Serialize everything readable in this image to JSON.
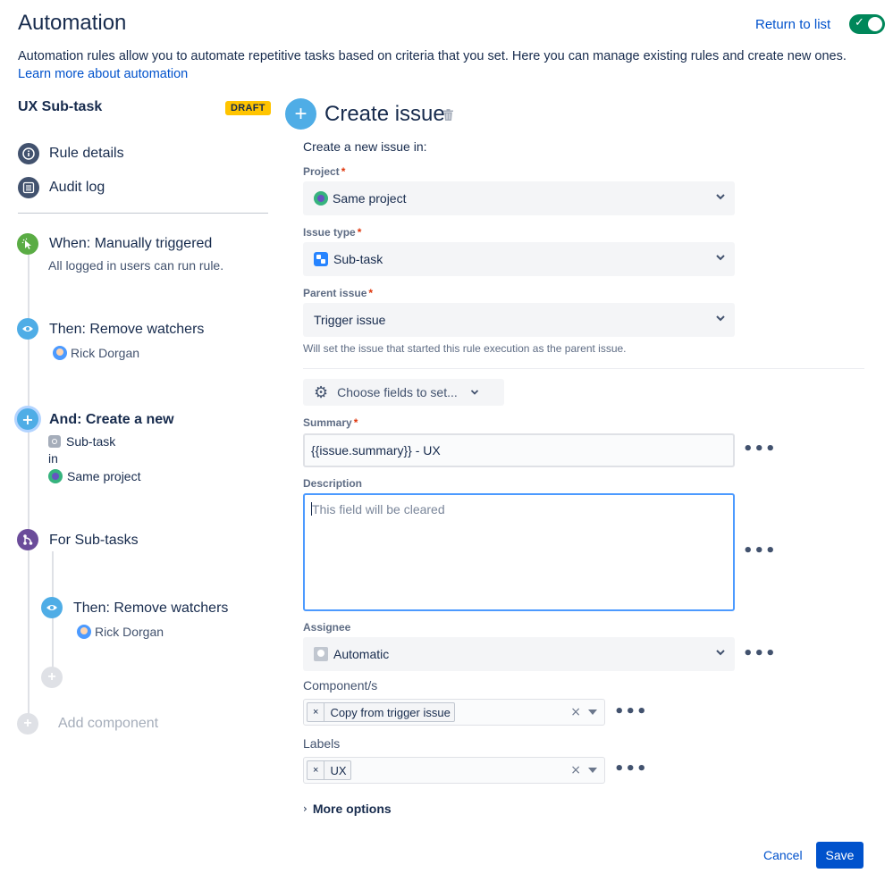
{
  "header": {
    "title": "Automation",
    "return_label": "Return to list",
    "toggle_on": true,
    "intro_text": "Automation rules allow you to automate repetitive tasks based on criteria that you set. Here you can manage existing rules and create new ones. ",
    "intro_link": "Learn more about automation"
  },
  "rule": {
    "name": "UX Sub-task",
    "badge": "DRAFT",
    "nav": [
      {
        "label": "Rule details",
        "icon": "info-icon"
      },
      {
        "label": "Audit log",
        "icon": "list-icon"
      }
    ]
  },
  "steps": {
    "trigger": {
      "title": "When: Manually triggered",
      "sub": "All logged in users can run rule.",
      "icon": "cursor-click-icon",
      "color": "#5aac44"
    },
    "remove1": {
      "title": "Then: Remove watchers",
      "user": "Rick Dorgan",
      "icon": "eye-icon",
      "color": "#4fade6"
    },
    "create": {
      "title": "And: Create a new",
      "issue_type": "Sub-task",
      "in": "in",
      "project": "Same project",
      "icon": "plus-icon",
      "color": "#4fade6"
    },
    "branch": {
      "title": "For Sub-tasks",
      "icon": "branch-icon",
      "color": "#6b4c9a"
    },
    "remove2": {
      "title": "Then: Remove watchers",
      "user": "Rick Dorgan",
      "icon": "eye-icon",
      "color": "#4fade6"
    },
    "add_component": "Add component"
  },
  "form": {
    "title": "Create issue",
    "create_in": "Create a new issue in:",
    "project": {
      "label": "Project",
      "value": "Same project"
    },
    "issue_type": {
      "label": "Issue type",
      "value": "Sub-task"
    },
    "parent": {
      "label": "Parent issue",
      "value": "Trigger issue",
      "hint": "Will set the issue that started this rule execution as the parent issue."
    },
    "choose_fields": "Choose fields to set...",
    "summary": {
      "label": "Summary",
      "value": "{{issue.summary}} - UX"
    },
    "description": {
      "label": "Description",
      "placeholder": "This field will be cleared"
    },
    "assignee": {
      "label": "Assignee",
      "value": "Automatic"
    },
    "components": {
      "label": "Component/s",
      "chip": "Copy from trigger issue"
    },
    "labels": {
      "label": "Labels",
      "chip": "UX"
    },
    "more_options": "More options",
    "required_mark": "*",
    "more_dots": "•••"
  },
  "footer": {
    "cancel": "Cancel",
    "save": "Save"
  },
  "colors": {
    "primary": "#0052cc",
    "success": "#00875a",
    "draft": "#ffc400",
    "focus": "#4c9aff"
  }
}
